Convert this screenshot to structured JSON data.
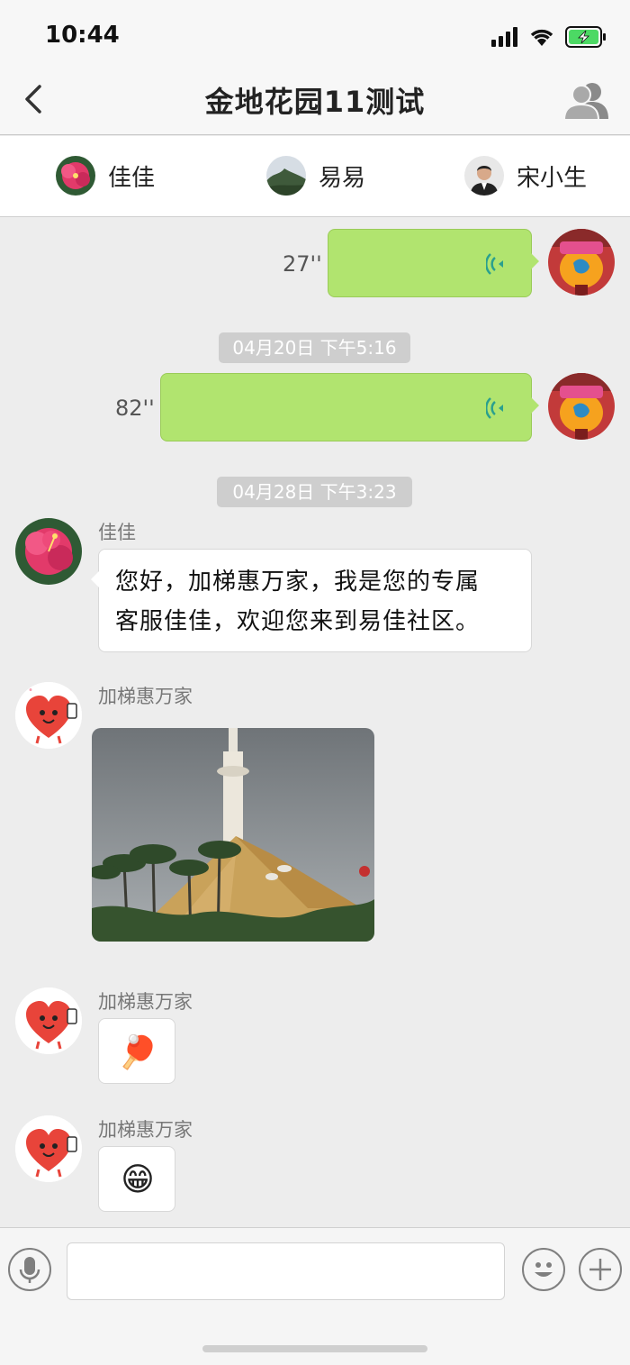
{
  "status": {
    "time": "10:44"
  },
  "nav": {
    "title": "金地花园11测试"
  },
  "members": [
    {
      "name": "佳佳"
    },
    {
      "name": "易易"
    },
    {
      "name": "宋小生"
    }
  ],
  "messages": {
    "voice1": {
      "duration": "27''"
    },
    "stamp1": "04月20日 下午5:16",
    "voice2": {
      "duration": "82''"
    },
    "stamp2": "04月28日 下午3:23",
    "text1": {
      "sender": "佳佳",
      "lines": [
        "您好，加梯惠万家，我是您的专属",
        "客服佳佳，欢迎您来到易佳社区。"
      ]
    },
    "image1": {
      "sender": "加梯惠万家"
    },
    "sticker1": {
      "sender": "加梯惠万家",
      "emoji": "🏓"
    },
    "sticker2": {
      "sender": "加梯惠万家",
      "emoji": "😁"
    }
  },
  "colors": {
    "voice_bubble": "#b1e46f",
    "battery": "#4cd964",
    "wave": "#2aa08e"
  },
  "icons": [
    "back-arrow-icon",
    "group-members-icon",
    "voice-wave-icon",
    "microphone-icon",
    "emoji-icon",
    "plus-icon"
  ]
}
